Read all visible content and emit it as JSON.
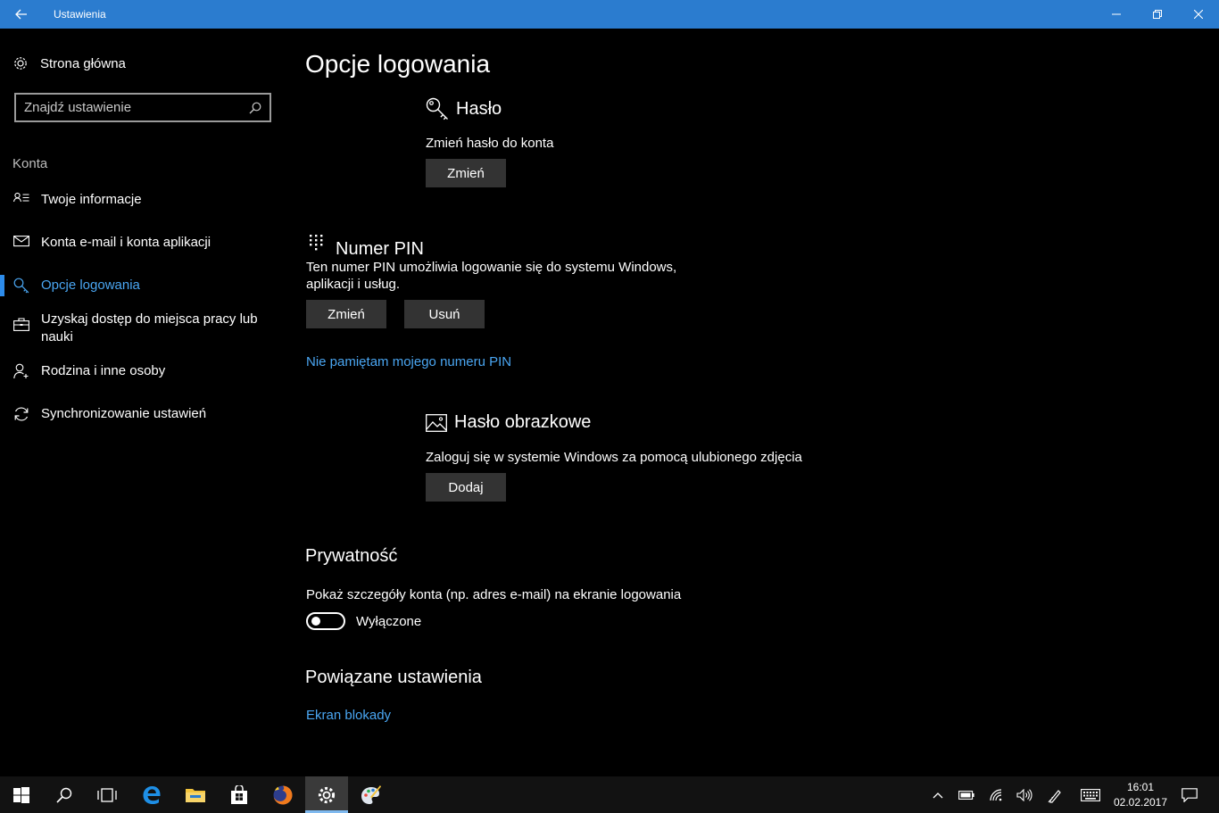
{
  "window": {
    "title": "Ustawienia"
  },
  "sidebar": {
    "home_label": "Strona główna",
    "search_placeholder": "Znajdź ustawienie",
    "section_label": "Konta",
    "items": [
      {
        "label": "Twoje informacje",
        "icon": "user-info-icon",
        "active": false
      },
      {
        "label": "Konta e-mail i konta aplikacji",
        "icon": "mail-icon",
        "active": false
      },
      {
        "label": "Opcje logowania",
        "icon": "key-icon",
        "active": true
      },
      {
        "label": "Uzyskaj dostęp do miejsca pracy lub nauki",
        "icon": "briefcase-icon",
        "active": false
      },
      {
        "label": "Rodzina i inne osoby",
        "icon": "person-add-icon",
        "active": false
      },
      {
        "label": "Synchronizowanie ustawień",
        "icon": "sync-icon",
        "active": false
      }
    ]
  },
  "main": {
    "page_title": "Opcje logowania",
    "password": {
      "heading": "Hasło",
      "description": "Zmień hasło do konta",
      "change_button": "Zmień"
    },
    "pin": {
      "heading": "Numer PIN",
      "description_line1": "Ten numer PIN umożliwia logowanie się do systemu Windows,",
      "description_line2": "aplikacji i usług.",
      "change_button": "Zmień",
      "remove_button": "Usuń",
      "forgot_link": "Nie pamiętam mojego numeru PIN"
    },
    "picture_password": {
      "heading": "Hasło obrazkowe",
      "description": "Zaloguj się w systemie Windows za pomocą ulubionego zdjęcia",
      "add_button": "Dodaj"
    },
    "privacy": {
      "heading": "Prywatność",
      "description": "Pokaż szczegóły konta (np. adres e-mail) na ekranie logowania",
      "toggle_state": "Wyłączone",
      "toggle_on": false
    },
    "related": {
      "heading": "Powiązane ustawienia",
      "lock_screen_link": "Ekran blokady"
    }
  },
  "taskbar": {
    "time": "16:01",
    "date": "02.02.2017",
    "apps": [
      "windows-start-icon",
      "search-icon",
      "task-view-icon",
      "edge-icon",
      "file-explorer-icon",
      "store-icon",
      "firefox-icon",
      "settings-gear-icon",
      "paint-icon"
    ],
    "active_app": "settings-gear-icon"
  },
  "colors": {
    "titlebar": "#2b7ccf",
    "accent_link": "#4aa6f2",
    "button_bg": "#333333",
    "background": "#000000"
  }
}
